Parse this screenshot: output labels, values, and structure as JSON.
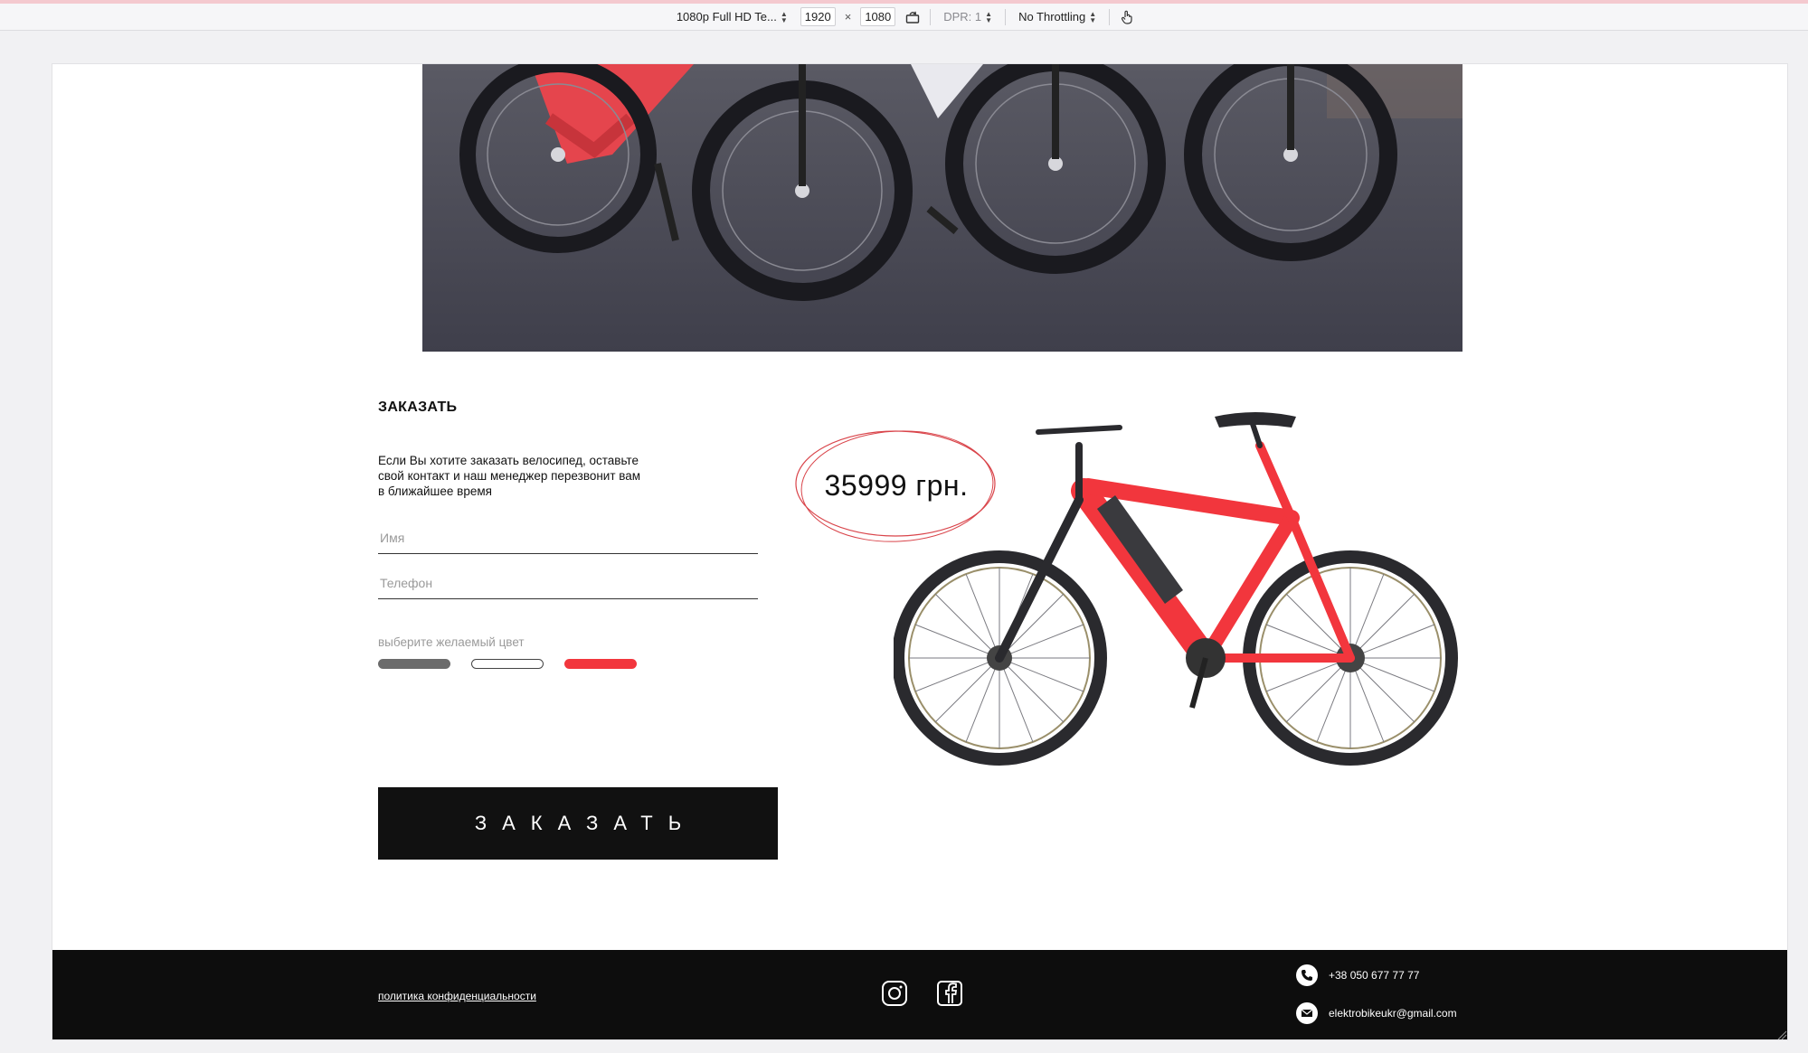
{
  "devtools": {
    "device": "1080p Full HD Te...",
    "width": "1920",
    "times": "×",
    "height": "1080",
    "dpr": "DPR: 1",
    "throttling": "No Throttling"
  },
  "order": {
    "title": "ЗАКАЗАТЬ",
    "description": "Если Вы хотите заказать велосипед, оставьте свой контакт и наш менеджер перезвонит вам в ближайшее время",
    "name_placeholder": "Имя",
    "phone_placeholder": "Телефон",
    "color_label": "выберите желаемый цвет",
    "colors": [
      "#6b6b6b",
      "#ffffff",
      "#f2363d"
    ],
    "button_label": "ЗАКАЗАТЬ"
  },
  "product": {
    "price": "35999 грн.",
    "frame_color": "#f2363d"
  },
  "footer": {
    "privacy_link": "политика конфиденциальности",
    "phone": "+38 050 677 77 77",
    "email": "elektrobikeukr@gmail.com"
  }
}
